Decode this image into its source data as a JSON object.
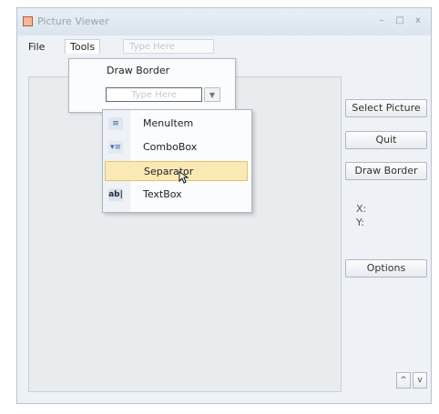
{
  "window": {
    "title": "Picture Viewer",
    "controls": {
      "minimize": "–",
      "maximize": "□",
      "close": "x"
    }
  },
  "menubar": {
    "file": "File",
    "tools": "Tools",
    "type_here": "Type Here"
  },
  "tools_menu": {
    "draw_border": "Draw Border",
    "type_here": "Type Here"
  },
  "type_submenu": {
    "items": [
      {
        "icon": "menu-item-icon",
        "label": "MenuItem"
      },
      {
        "icon": "combo-box-icon",
        "label": "ComboBox"
      },
      {
        "icon": "separator-icon",
        "label": "Separator",
        "highlighted": true
      },
      {
        "icon": "text-box-icon",
        "label": "TextBox"
      }
    ]
  },
  "sidebar": {
    "select_picture": "Select Picture",
    "quit": "Quit",
    "draw_border": "Draw Border",
    "x_label": "X:",
    "y_label": "Y:",
    "options": "Options",
    "up": "^",
    "down": "v"
  },
  "colors": {
    "highlight": "#fbe9b5",
    "highlight_border": "#e2c46f",
    "window_bg": "#eef1f5"
  }
}
